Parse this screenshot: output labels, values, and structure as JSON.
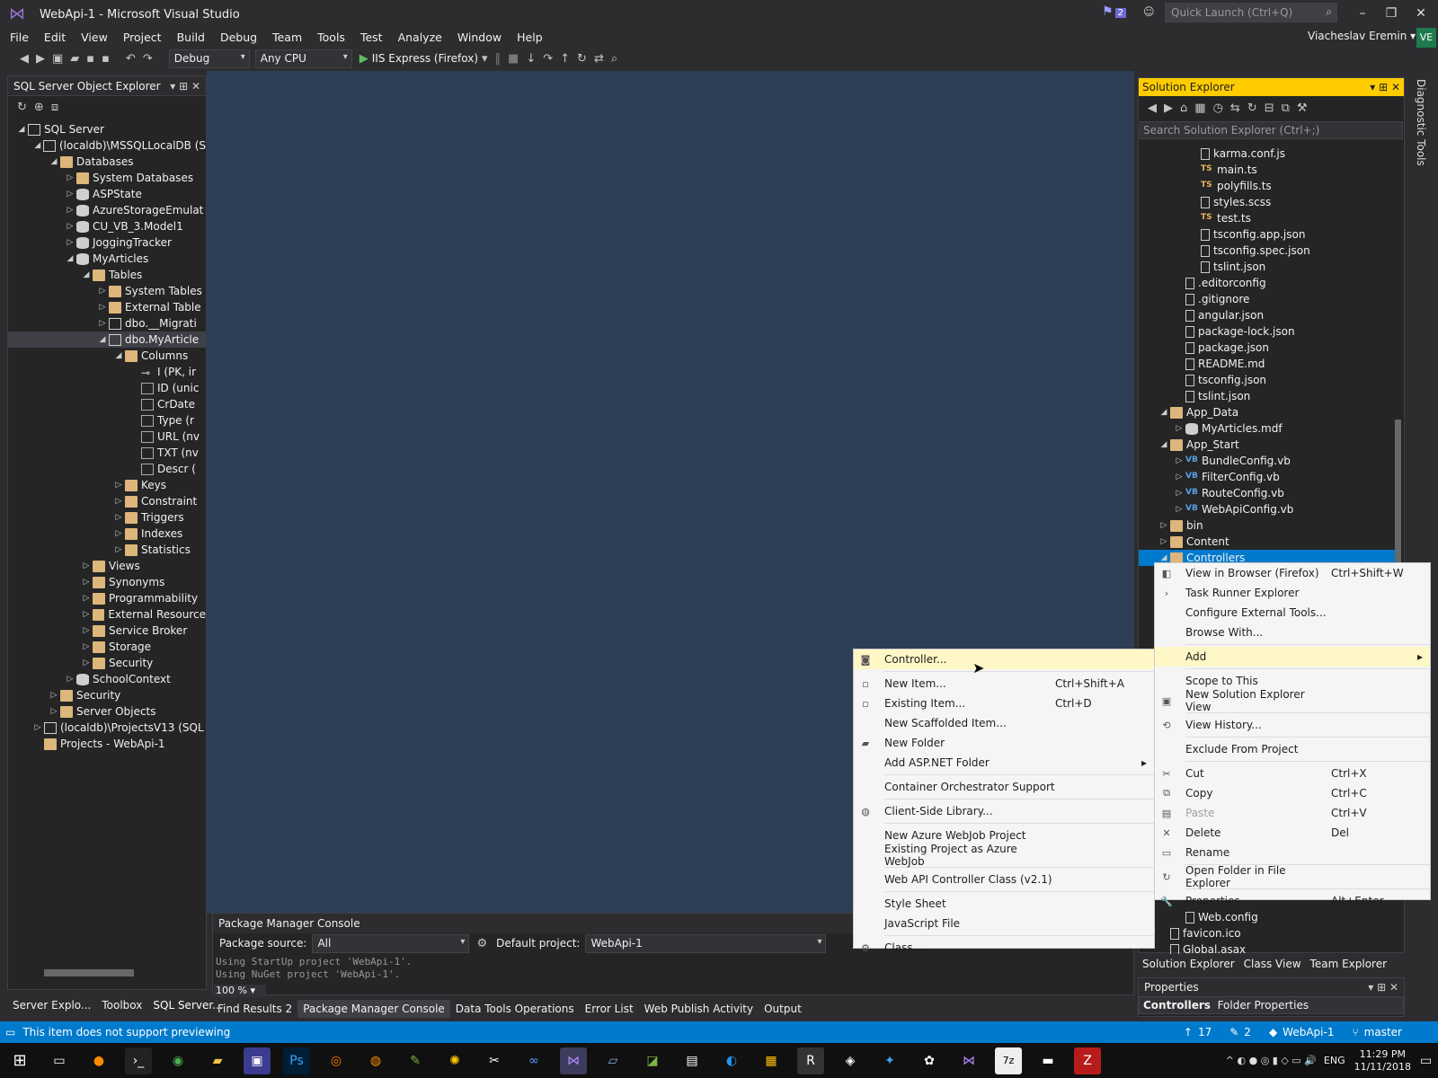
{
  "title_bar": {
    "title": "WebApi-1 - Microsoft Visual Studio",
    "notifications_count": "2",
    "quick_launch_placeholder": "Quick Launch (Ctrl+Q)"
  },
  "menu": [
    "File",
    "Edit",
    "View",
    "Project",
    "Build",
    "Debug",
    "Team",
    "Tools",
    "Test",
    "Analyze",
    "Window",
    "Help"
  ],
  "user": {
    "name": "Viacheslav Eremin",
    "initials": "VE"
  },
  "toolbar": {
    "config": "Debug",
    "platform": "Any CPU",
    "run_target": "IIS Express (Firefox)"
  },
  "sql_explorer": {
    "title": "SQL Server Object Explorer",
    "tree": [
      {
        "label": "SQL Server",
        "depth": 0,
        "icon": "server",
        "arrow": "down"
      },
      {
        "label": "(localdb)\\MSSQLLocalDB (S",
        "depth": 1,
        "icon": "server",
        "arrow": "down"
      },
      {
        "label": "Databases",
        "depth": 2,
        "icon": "folder",
        "arrow": "down"
      },
      {
        "label": "System Databases",
        "depth": 3,
        "icon": "folder",
        "arrow": "right"
      },
      {
        "label": "ASPState",
        "depth": 3,
        "icon": "db",
        "arrow": "right"
      },
      {
        "label": "AzureStorageEmulat",
        "depth": 3,
        "icon": "db",
        "arrow": "right"
      },
      {
        "label": "CU_VB_3.Model1",
        "depth": 3,
        "icon": "db",
        "arrow": "right"
      },
      {
        "label": "JoggingTracker",
        "depth": 3,
        "icon": "db",
        "arrow": "right"
      },
      {
        "label": "MyArticles",
        "depth": 3,
        "icon": "db",
        "arrow": "down"
      },
      {
        "label": "Tables",
        "depth": 4,
        "icon": "folder",
        "arrow": "down"
      },
      {
        "label": "System Tables",
        "depth": 5,
        "icon": "folder",
        "arrow": "right"
      },
      {
        "label": "External Table",
        "depth": 5,
        "icon": "folder",
        "arrow": "right"
      },
      {
        "label": "dbo.__Migrati",
        "depth": 5,
        "icon": "table",
        "arrow": "right"
      },
      {
        "label": "dbo.MyArticle",
        "depth": 5,
        "icon": "table",
        "arrow": "down",
        "selected": true
      },
      {
        "label": "Columns",
        "depth": 6,
        "icon": "folder",
        "arrow": "down"
      },
      {
        "label": "I (PK, ir",
        "depth": 7,
        "icon": "key",
        "arrow": ""
      },
      {
        "label": "ID (unic",
        "depth": 7,
        "icon": "col",
        "arrow": ""
      },
      {
        "label": "CrDate",
        "depth": 7,
        "icon": "col",
        "arrow": ""
      },
      {
        "label": "Type (r",
        "depth": 7,
        "icon": "col",
        "arrow": ""
      },
      {
        "label": "URL (nv",
        "depth": 7,
        "icon": "col",
        "arrow": ""
      },
      {
        "label": "TXT (nv",
        "depth": 7,
        "icon": "col",
        "arrow": ""
      },
      {
        "label": "Descr (",
        "depth": 7,
        "icon": "col",
        "arrow": ""
      },
      {
        "label": "Keys",
        "depth": 6,
        "icon": "folder",
        "arrow": "right"
      },
      {
        "label": "Constraint",
        "depth": 6,
        "icon": "folder",
        "arrow": "right"
      },
      {
        "label": "Triggers",
        "depth": 6,
        "icon": "folder",
        "arrow": "right"
      },
      {
        "label": "Indexes",
        "depth": 6,
        "icon": "folder",
        "arrow": "right"
      },
      {
        "label": "Statistics",
        "depth": 6,
        "icon": "folder",
        "arrow": "right"
      },
      {
        "label": "Views",
        "depth": 4,
        "icon": "folder",
        "arrow": "right"
      },
      {
        "label": "Synonyms",
        "depth": 4,
        "icon": "folder",
        "arrow": "right"
      },
      {
        "label": "Programmability",
        "depth": 4,
        "icon": "folder",
        "arrow": "right"
      },
      {
        "label": "External Resource",
        "depth": 4,
        "icon": "folder",
        "arrow": "right"
      },
      {
        "label": "Service Broker",
        "depth": 4,
        "icon": "folder",
        "arrow": "right"
      },
      {
        "label": "Storage",
        "depth": 4,
        "icon": "folder",
        "arrow": "right"
      },
      {
        "label": "Security",
        "depth": 4,
        "icon": "folder",
        "arrow": "right"
      },
      {
        "label": "SchoolContext",
        "depth": 3,
        "icon": "db",
        "arrow": "right"
      },
      {
        "label": "Security",
        "depth": 2,
        "icon": "folder",
        "arrow": "right"
      },
      {
        "label": "Server Objects",
        "depth": 2,
        "icon": "folder",
        "arrow": "right"
      },
      {
        "label": "(localdb)\\ProjectsV13 (SQL",
        "depth": 1,
        "icon": "server",
        "arrow": "right"
      },
      {
        "label": "Projects - WebApi-1",
        "depth": 1,
        "icon": "folder",
        "arrow": ""
      }
    ],
    "tabs": [
      "Server Explo...",
      "Toolbox",
      "SQL Server..."
    ]
  },
  "solution_explorer": {
    "title": "Solution Explorer",
    "search_placeholder": "Search Solution Explorer (Ctrl+;)",
    "tree": [
      {
        "label": "karma.conf.js",
        "depth": 3,
        "icon": "file",
        "arrow": ""
      },
      {
        "label": "main.ts",
        "depth": 3,
        "icon": "ts",
        "arrow": ""
      },
      {
        "label": "polyfills.ts",
        "depth": 3,
        "icon": "ts",
        "arrow": ""
      },
      {
        "label": "styles.scss",
        "depth": 3,
        "icon": "file",
        "arrow": ""
      },
      {
        "label": "test.ts",
        "depth": 3,
        "icon": "ts",
        "arrow": ""
      },
      {
        "label": "tsconfig.app.json",
        "depth": 3,
        "icon": "file",
        "arrow": ""
      },
      {
        "label": "tsconfig.spec.json",
        "depth": 3,
        "icon": "file",
        "arrow": ""
      },
      {
        "label": "tslint.json",
        "depth": 3,
        "icon": "file",
        "arrow": ""
      },
      {
        "label": ".editorconfig",
        "depth": 2,
        "icon": "file",
        "arrow": ""
      },
      {
        "label": ".gitignore",
        "depth": 2,
        "icon": "file",
        "arrow": ""
      },
      {
        "label": "angular.json",
        "depth": 2,
        "icon": "file",
        "arrow": ""
      },
      {
        "label": "package-lock.json",
        "depth": 2,
        "icon": "file",
        "arrow": ""
      },
      {
        "label": "package.json",
        "depth": 2,
        "icon": "file",
        "arrow": ""
      },
      {
        "label": "README.md",
        "depth": 2,
        "icon": "file",
        "arrow": ""
      },
      {
        "label": "tsconfig.json",
        "depth": 2,
        "icon": "file",
        "arrow": ""
      },
      {
        "label": "tslint.json",
        "depth": 2,
        "icon": "file",
        "arrow": ""
      },
      {
        "label": "App_Data",
        "depth": 1,
        "icon": "folder",
        "arrow": "down"
      },
      {
        "label": "MyArticles.mdf",
        "depth": 2,
        "icon": "db",
        "arrow": "right"
      },
      {
        "label": "App_Start",
        "depth": 1,
        "icon": "folder",
        "arrow": "down"
      },
      {
        "label": "BundleConfig.vb",
        "depth": 2,
        "icon": "vb",
        "arrow": "right"
      },
      {
        "label": "FilterConfig.vb",
        "depth": 2,
        "icon": "vb",
        "arrow": "right"
      },
      {
        "label": "RouteConfig.vb",
        "depth": 2,
        "icon": "vb",
        "arrow": "right"
      },
      {
        "label": "WebApiConfig.vb",
        "depth": 2,
        "icon": "vb",
        "arrow": "right"
      },
      {
        "label": "bin",
        "depth": 1,
        "icon": "folder",
        "arrow": "right"
      },
      {
        "label": "Content",
        "depth": 1,
        "icon": "folder",
        "arrow": "right"
      },
      {
        "label": "Controllers",
        "depth": 1,
        "icon": "folder",
        "arrow": "down",
        "selected": true
      }
    ],
    "tail": [
      {
        "label": "Web.config",
        "depth": 2,
        "icon": "file",
        "arrow": ""
      },
      {
        "label": "favicon.ico",
        "depth": 1,
        "icon": "file",
        "arrow": ""
      },
      {
        "label": "Global.asax",
        "depth": 1,
        "icon": "file",
        "arrow": ""
      }
    ],
    "tabs": [
      "Solution Explorer",
      "Class View",
      "Team Explorer"
    ]
  },
  "properties": {
    "title": "Properties",
    "object": "Controllers",
    "object_type": "Folder Properties"
  },
  "package_console": {
    "title": "Package Manager Console",
    "source_label": "Package source:",
    "source": "All",
    "project_label": "Default project:",
    "project": "WebApi-1",
    "log": [
      "Using StartUp project 'WebApi-1'.",
      "Using NuGet project 'WebApi-1'."
    ],
    "zoom": "100 %"
  },
  "bottom_tabs": [
    "Find Results 2",
    "Package Manager Console",
    "Data Tools Operations",
    "Error List",
    "Web Publish Activity",
    "Output"
  ],
  "status": {
    "message": "This item does not support previewing",
    "up_count": "17",
    "edit_count": "2",
    "project": "WebApi-1",
    "branch": "master"
  },
  "taskbar": {
    "lang": "ENG",
    "time": "11:29 PM",
    "date": "11/11/2018"
  },
  "context_menu": [
    {
      "label": "View in Browser (Firefox)",
      "shortcut": "Ctrl+Shift+W",
      "icon": "◧"
    },
    {
      "label": "Task Runner Explorer",
      "shortcut": "",
      "icon": "›"
    },
    {
      "label": "Configure External Tools...",
      "shortcut": "",
      "icon": ""
    },
    {
      "label": "Browse With...",
      "shortcut": "",
      "icon": ""
    },
    {
      "sep": true
    },
    {
      "label": "Add",
      "shortcut": "",
      "icon": "",
      "submenu": true,
      "highlight": true
    },
    {
      "sep": true
    },
    {
      "label": "Scope to This",
      "shortcut": "",
      "icon": ""
    },
    {
      "label": "New Solution Explorer View",
      "shortcut": "",
      "icon": "▣"
    },
    {
      "sep": true
    },
    {
      "label": "View History...",
      "shortcut": "",
      "icon": "⟲"
    },
    {
      "sep": true
    },
    {
      "label": "Exclude From Project",
      "shortcut": "",
      "icon": ""
    },
    {
      "sep": true
    },
    {
      "label": "Cut",
      "shortcut": "Ctrl+X",
      "icon": "✂"
    },
    {
      "label": "Copy",
      "shortcut": "Ctrl+C",
      "icon": "⧉"
    },
    {
      "label": "Paste",
      "shortcut": "Ctrl+V",
      "icon": "▤",
      "disabled": true
    },
    {
      "label": "Delete",
      "shortcut": "Del",
      "icon": "✕"
    },
    {
      "label": "Rename",
      "shortcut": "",
      "icon": "▭"
    },
    {
      "sep": true
    },
    {
      "label": "Open Folder in File Explorer",
      "shortcut": "",
      "icon": "↻"
    },
    {
      "sep": true
    },
    {
      "label": "Properties",
      "shortcut": "Alt+Enter",
      "icon": "🔧"
    }
  ],
  "add_submenu": [
    {
      "label": "Controller...",
      "shortcut": "",
      "icon": "◙",
      "highlight": true
    },
    {
      "sep": true
    },
    {
      "label": "New Item...",
      "shortcut": "Ctrl+Shift+A",
      "icon": "▫"
    },
    {
      "label": "Existing Item...",
      "shortcut": "Ctrl+D",
      "icon": "▫"
    },
    {
      "label": "New Scaffolded Item...",
      "shortcut": "",
      "icon": ""
    },
    {
      "label": "New Folder",
      "shortcut": "",
      "icon": "▰"
    },
    {
      "label": "Add ASP.NET Folder",
      "shortcut": "",
      "icon": "",
      "submenu": true
    },
    {
      "sep": true
    },
    {
      "label": "Container Orchestrator Support",
      "shortcut": "",
      "icon": ""
    },
    {
      "sep": true
    },
    {
      "label": "Client-Side Library...",
      "shortcut": "",
      "icon": "◍"
    },
    {
      "sep": true
    },
    {
      "label": "New Azure WebJob Project",
      "shortcut": "",
      "icon": ""
    },
    {
      "label": "Existing Project as Azure WebJob",
      "shortcut": "",
      "icon": ""
    },
    {
      "sep": true
    },
    {
      "label": "Web API Controller Class (v2.1)",
      "shortcut": "",
      "icon": ""
    },
    {
      "sep": true
    },
    {
      "label": "Style Sheet",
      "shortcut": "",
      "icon": ""
    },
    {
      "label": "JavaScript File",
      "shortcut": "",
      "icon": ""
    },
    {
      "sep": true
    },
    {
      "label": "Class...",
      "shortcut": "",
      "icon": "⚙"
    }
  ]
}
